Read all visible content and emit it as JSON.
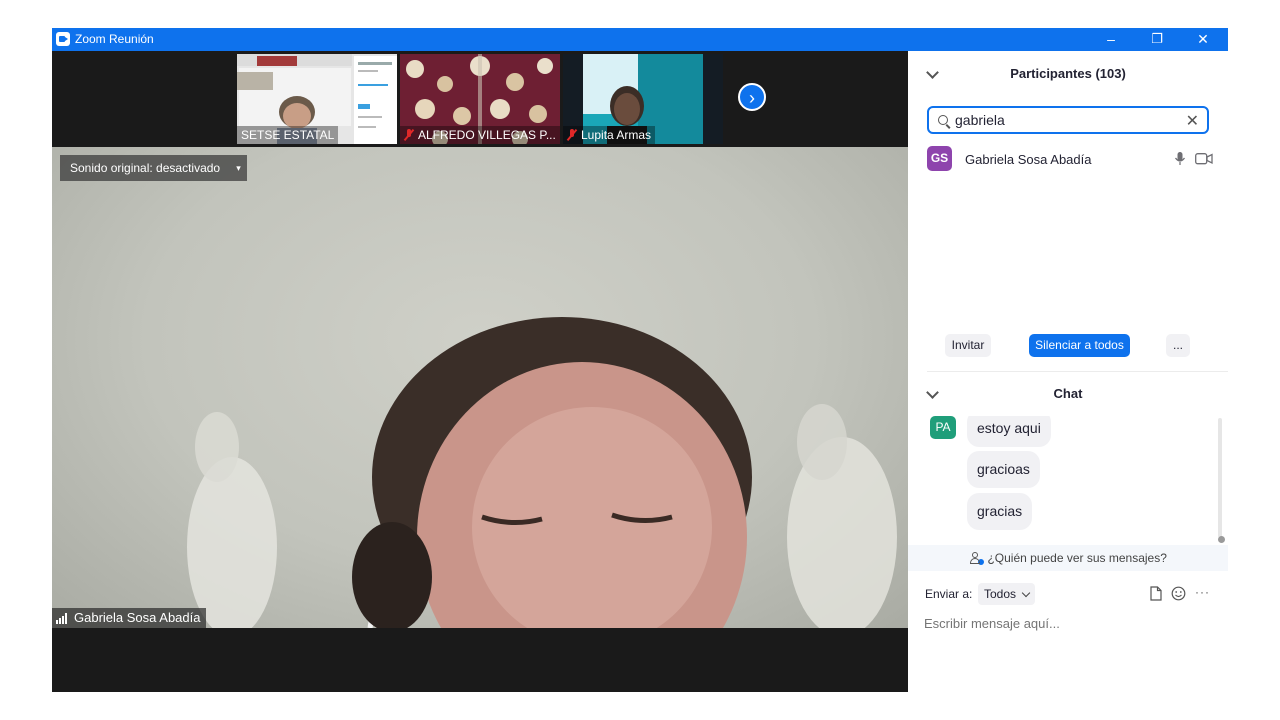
{
  "window": {
    "title": "Zoom Reunión",
    "minimize": "–",
    "restore": "❐",
    "close": "✕"
  },
  "thumbnails": [
    {
      "name": "SETSE ESTATAL",
      "muted": false
    },
    {
      "name": "ALFREDO VILLEGAS P...",
      "muted": true
    },
    {
      "name": "Lupita Armas",
      "muted": true
    }
  ],
  "thumbnail_next": "›",
  "main_video": {
    "sound_label": "Sonido original: desactivado",
    "sound_dropdown": "▾",
    "speaker_name": "Gabriela Sosa Abadía"
  },
  "participants": {
    "header": "Participantes (103)",
    "search_value": "gabriela",
    "clear": "✕",
    "results": [
      {
        "initials": "GS",
        "name": "Gabriela Sosa Abadía",
        "color": "#8e44ad"
      }
    ],
    "invite_label": "Invitar",
    "mute_all_label": "Silenciar a todos",
    "more_label": "..."
  },
  "chat": {
    "header": "Chat",
    "sender_initials": "PA",
    "sender_color": "#1f9e7a",
    "messages": [
      "estoy aqui",
      "gracioas",
      "gracias"
    ],
    "who_can_see": "¿Quién puede ver sus mensajes?",
    "send_to_label": "Enviar a:",
    "send_to_value": "Todos",
    "input_placeholder": "Escribir mensaje aquí...",
    "more_label": "···"
  },
  "colors": {
    "accent": "#0e72ed",
    "muted_red": "#e02828"
  }
}
